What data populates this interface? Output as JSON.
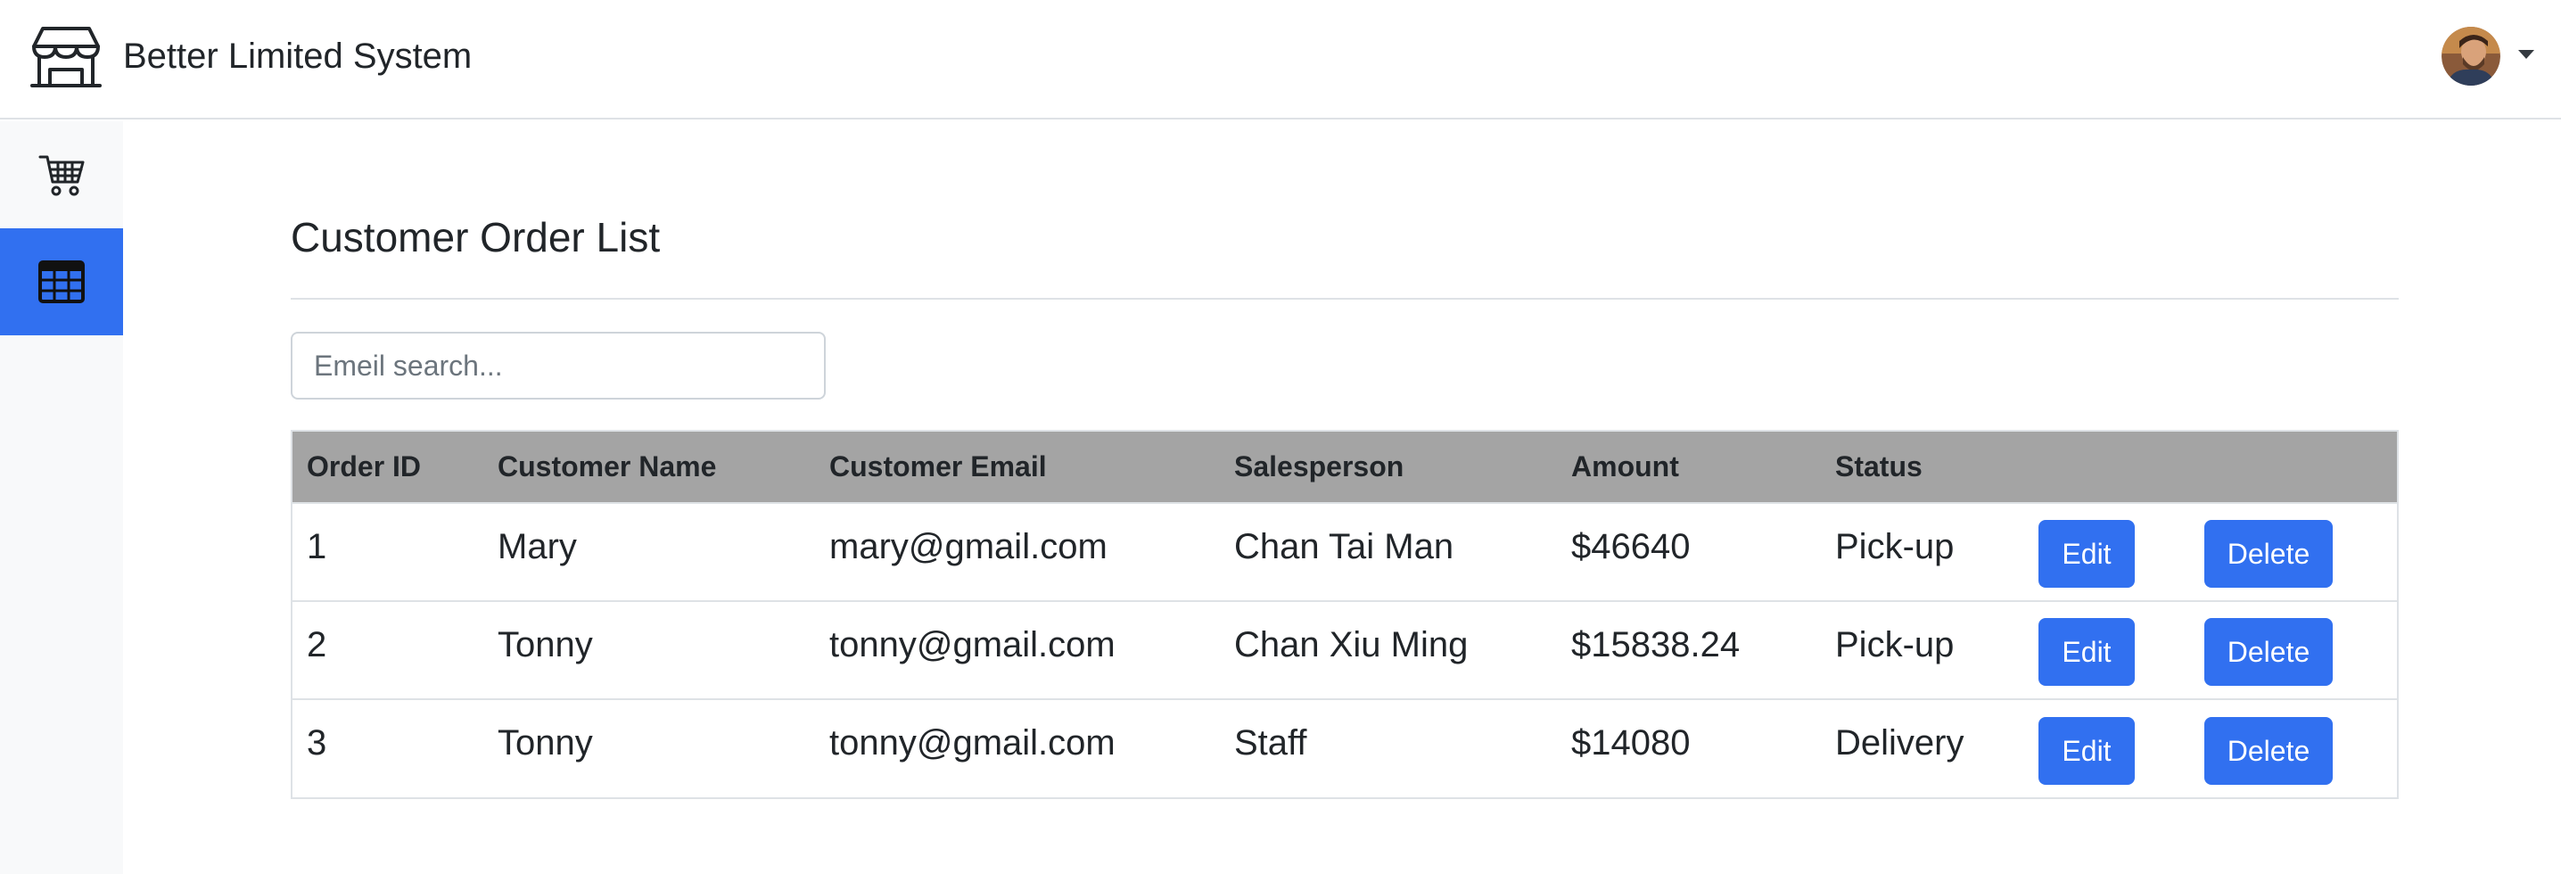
{
  "app": {
    "brand": "Better Limited System"
  },
  "sidebar": {
    "items": [
      {
        "icon": "cart-icon",
        "active": false
      },
      {
        "icon": "table-icon",
        "active": true
      }
    ]
  },
  "page": {
    "title": "Customer Order List"
  },
  "search": {
    "placeholder": "Emeil search...",
    "value": ""
  },
  "table": {
    "headers": {
      "order_id": "Order ID",
      "customer_name": "Customer Name",
      "customer_email": "Customer Email",
      "salesperson": "Salesperson",
      "amount": "Amount",
      "status": "Status"
    },
    "rows": [
      {
        "order_id": "1",
        "customer_name": "Mary",
        "customer_email": "mary@gmail.com",
        "salesperson": "Chan Tai Man",
        "amount": "$46640",
        "status": "Pick-up",
        "edit_label": "Edit",
        "delete_label": "Delete"
      },
      {
        "order_id": "2",
        "customer_name": "Tonny",
        "customer_email": "tonny@gmail.com",
        "salesperson": "Chan Xiu Ming",
        "amount": "$15838.24",
        "status": "Pick-up",
        "edit_label": "Edit",
        "delete_label": "Delete"
      },
      {
        "order_id": "3",
        "customer_name": "Tonny",
        "customer_email": "tonny@gmail.com",
        "salesperson": "Staff",
        "amount": "$14080",
        "status": "Delivery",
        "edit_label": "Edit",
        "delete_label": "Delete"
      }
    ]
  },
  "colors": {
    "accent": "#3170f0",
    "table_header_bg": "#a4a4a4",
    "sidebar_bg": "#f8f9fa"
  }
}
